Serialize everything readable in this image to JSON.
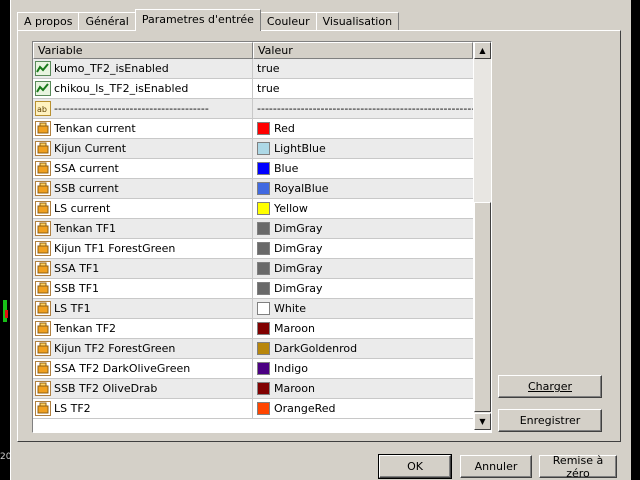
{
  "tabs": [
    "A propos",
    "Général",
    "Parametres d'entrée",
    "Couleur",
    "Visualisation"
  ],
  "active_tab": "Parametres d'entrée",
  "columns": {
    "variable": "Variable",
    "value": "Valeur"
  },
  "rows": [
    {
      "icon": "bool-icon",
      "name": "kumo_TF2_isEnabled",
      "value": "true"
    },
    {
      "icon": "bool-icon",
      "name": "chikou_ls_TF2_isEnabled",
      "value": "true"
    },
    {
      "icon": "string-icon",
      "name": "---------------------------------------",
      "value": "---------------------------------------------------------..."
    },
    {
      "icon": "color-icon",
      "name": "Tenkan current",
      "value": "Red",
      "color": "#ff0000"
    },
    {
      "icon": "color-icon",
      "name": "Kijun Current",
      "value": "LightBlue",
      "color": "#add8e6"
    },
    {
      "icon": "color-icon",
      "name": "SSA current",
      "value": "Blue",
      "color": "#0000ff"
    },
    {
      "icon": "color-icon",
      "name": "SSB current",
      "value": "RoyalBlue",
      "color": "#4169e1"
    },
    {
      "icon": "color-icon",
      "name": "LS current",
      "value": "Yellow",
      "color": "#ffff00"
    },
    {
      "icon": "color-icon",
      "name": "Tenkan TF1",
      "value": "DimGray",
      "color": "#696969"
    },
    {
      "icon": "color-icon",
      "name": "Kijun TF1  ForestGreen",
      "value": "DimGray",
      "color": "#696969"
    },
    {
      "icon": "color-icon",
      "name": "SSA TF1",
      "value": "DimGray",
      "color": "#696969"
    },
    {
      "icon": "color-icon",
      "name": "SSB TF1",
      "value": "DimGray",
      "color": "#696969"
    },
    {
      "icon": "color-icon",
      "name": "LS TF1",
      "value": "White",
      "color": "#ffffff"
    },
    {
      "icon": "color-icon",
      "name": "Tenkan TF2",
      "value": "Maroon",
      "color": "#800000"
    },
    {
      "icon": "color-icon",
      "name": "Kijun TF2  ForestGreen",
      "value": "DarkGoldenrod",
      "color": "#b8860b"
    },
    {
      "icon": "color-icon",
      "name": "SSA TF2 DarkOliveGreen",
      "value": "Indigo",
      "color": "#4b0082"
    },
    {
      "icon": "color-icon",
      "name": "SSB TF2 OliveDrab",
      "value": "Maroon",
      "color": "#800000"
    },
    {
      "icon": "color-icon",
      "name": "LS TF2",
      "value": "OrangeRed",
      "color": "#ff4500"
    }
  ],
  "buttons": {
    "load": "Charger",
    "save": "Enregistrer",
    "ok": "OK",
    "cancel": "Annuler",
    "reset": "Remise à zéro"
  },
  "background_number": "20"
}
